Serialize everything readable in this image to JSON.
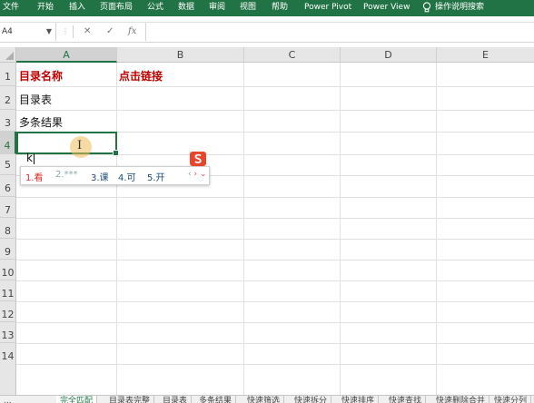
{
  "ribbon": {
    "tabs": [
      {
        "label": "文件"
      },
      {
        "label": "开始"
      },
      {
        "label": "插入"
      },
      {
        "label": "页面布局"
      },
      {
        "label": "公式"
      },
      {
        "label": "数据"
      },
      {
        "label": "审阅"
      },
      {
        "label": "视图"
      },
      {
        "label": "帮助"
      },
      {
        "label": "Power Pivot"
      },
      {
        "label": "Power View"
      }
    ],
    "tell_me": "操作说明搜索",
    "bg_color": "#217346"
  },
  "formula_bar": {
    "name_box": "A4",
    "cancel": "✕",
    "enter": "✓",
    "fx": "fx",
    "value": ""
  },
  "grid": {
    "columns": [
      "A",
      "B",
      "C",
      "D",
      "E"
    ],
    "selected_column": "A",
    "rows": [
      "1",
      "2",
      "3",
      "4",
      "5",
      "6",
      "7",
      "8",
      "9",
      "10",
      "11",
      "12",
      "13",
      "14"
    ],
    "selected_row": "4",
    "cells": {
      "A1": "目录名称",
      "B1": "点击链接",
      "A2": "目录表",
      "A3": "多条结果"
    },
    "typed_text": "k"
  },
  "ime": {
    "candidates": [
      "1.看",
      "2.***",
      "3.课",
      "4.可",
      "5.开"
    ],
    "brand_color": "#e8452c"
  },
  "sheets": {
    "tabs": [
      "...",
      "完全匹配",
      "目录表完整",
      "目录表",
      "多条结果",
      "快速筛选",
      "快速拆分",
      "快速排序",
      "快速查找",
      "快速删除合并",
      "快速分列"
    ],
    "active_index": 1
  }
}
